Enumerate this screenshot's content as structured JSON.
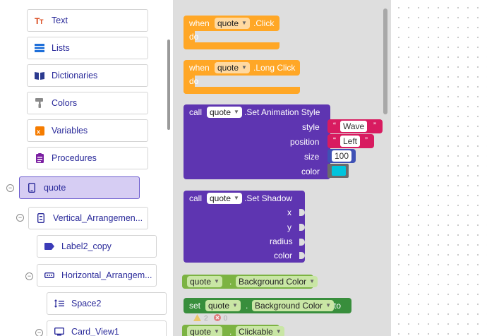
{
  "tree": {
    "nodes": [
      {
        "label": "Text"
      },
      {
        "label": "Lists"
      },
      {
        "label": "Dictionaries"
      },
      {
        "label": "Colors"
      },
      {
        "label": "Variables"
      },
      {
        "label": "Procedures"
      },
      {
        "label": "quote"
      },
      {
        "label": "Vertical_Arrangemen..."
      },
      {
        "label": "Label2_copy"
      },
      {
        "label": "Horizontal_Arrangem..."
      },
      {
        "label": "Space2"
      },
      {
        "label": "Card_View1"
      }
    ],
    "toggle_symbol": "−"
  },
  "blocks": {
    "click": {
      "when": "when",
      "component": "quote",
      "event": ".Click",
      "do": "do"
    },
    "long_click": {
      "when": "when",
      "component": "quote",
      "event": ".Long Click",
      "do": "do"
    },
    "set_animation": {
      "call": "call",
      "component": "quote",
      "method": ".Set Animation Style",
      "params": {
        "style": "style",
        "position": "position",
        "size": "size",
        "color": "color"
      },
      "style_value": "Wave",
      "position_value": "Left",
      "size_value": "100",
      "quote_open": "“",
      "quote_close": "”",
      "color_value": "#00c4dc"
    },
    "set_shadow": {
      "call": "call",
      "component": "quote",
      "method": ".Set Shadow",
      "params": {
        "x": "x",
        "y": "y",
        "radius": "radius",
        "color": "color"
      }
    },
    "getter_bg": {
      "component": "quote",
      "dot": ".",
      "property": "Background Color"
    },
    "setter_bg": {
      "set": "set",
      "component": "quote",
      "dot": ".",
      "property": "Background Color",
      "to": "to"
    },
    "getter_clickable": {
      "component": "quote",
      "dot": ".",
      "property": "Clickable"
    },
    "warnings": {
      "warn_count": "2",
      "error_count": "0"
    }
  },
  "colors": {
    "event": "#ffa726",
    "method": "#5e35b1",
    "getter": "#7cb342",
    "setter": "#388e3c",
    "text_literal": "#d81b60",
    "number": "#3f51b5",
    "selected": "#d6cdf3"
  },
  "icons": [
    "text-icon",
    "lists-icon",
    "dictionaries-icon",
    "colors-icon",
    "variables-icon",
    "procedures-icon",
    "phone-icon",
    "vertical-arrangement-icon",
    "label-icon",
    "horizontal-arrangement-icon",
    "space-icon",
    "card-view-icon"
  ]
}
